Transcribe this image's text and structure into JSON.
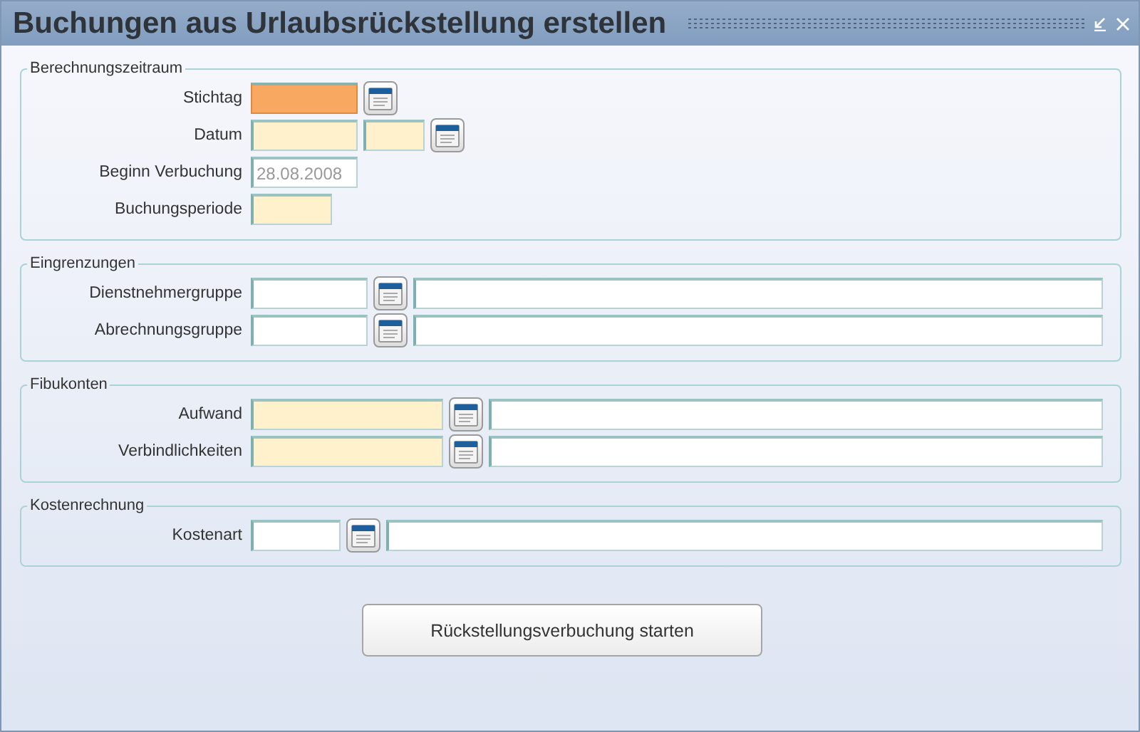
{
  "window": {
    "title": "Buchungen aus Urlaubsrückstellung erstellen"
  },
  "sections": [
    {
      "title": "Berechnungszeitraum",
      "rows": [
        {
          "label": "Stichtag",
          "fields": [
            {
              "kind": "date",
              "focused": true,
              "required": true
            },
            {
              "kind": "lookup"
            }
          ]
        },
        {
          "label": "Datum",
          "fields": [
            {
              "kind": "date",
              "focused": false,
              "required": true
            },
            {
              "kind": "day",
              "focused": false,
              "required": true
            },
            {
              "kind": "lookup"
            }
          ]
        },
        {
          "label": "Beginn Verbuchung",
          "fields": [
            {
              "kind": "date",
              "focused": false,
              "required": false,
              "value": "28.08.2008"
            }
          ]
        },
        {
          "label": "Buchungsperiode",
          "fields": [
            {
              "kind": "period",
              "focused": false,
              "required": true
            }
          ]
        }
      ]
    },
    {
      "title": "Eingrenzungen",
      "rows": [
        {
          "label": "Dienstnehmergruppe",
          "fields": [
            {
              "kind": "group",
              "focused": false,
              "required": false
            },
            {
              "kind": "lookup"
            },
            {
              "kind": "description",
              "focused": false,
              "required": false
            }
          ]
        },
        {
          "label": "Abrechnungsgruppe",
          "fields": [
            {
              "kind": "group",
              "focused": false,
              "required": false
            },
            {
              "kind": "lookup"
            },
            {
              "kind": "description",
              "focused": false,
              "required": false
            }
          ]
        }
      ]
    },
    {
      "title": "Fibukonten",
      "rows": [
        {
          "label": "Aufwand",
          "fields": [
            {
              "kind": "account",
              "focused": false,
              "required": true
            },
            {
              "kind": "lookup"
            },
            {
              "kind": "description",
              "focused": false,
              "required": false
            }
          ]
        },
        {
          "label": "Verbindlichkeiten",
          "fields": [
            {
              "kind": "account",
              "focused": false,
              "required": true
            },
            {
              "kind": "lookup"
            },
            {
              "kind": "description",
              "focused": false,
              "required": false
            }
          ]
        }
      ]
    },
    {
      "title": "Kostenrechnung",
      "rows": [
        {
          "label": "Kostenart",
          "fields": [
            {
              "kind": "cost",
              "focused": false,
              "required": false
            },
            {
              "kind": "lookup"
            },
            {
              "kind": "description",
              "focused": false,
              "required": false
            }
          ]
        }
      ]
    }
  ],
  "action_button": "Rückstellungsverbuchung starten"
}
